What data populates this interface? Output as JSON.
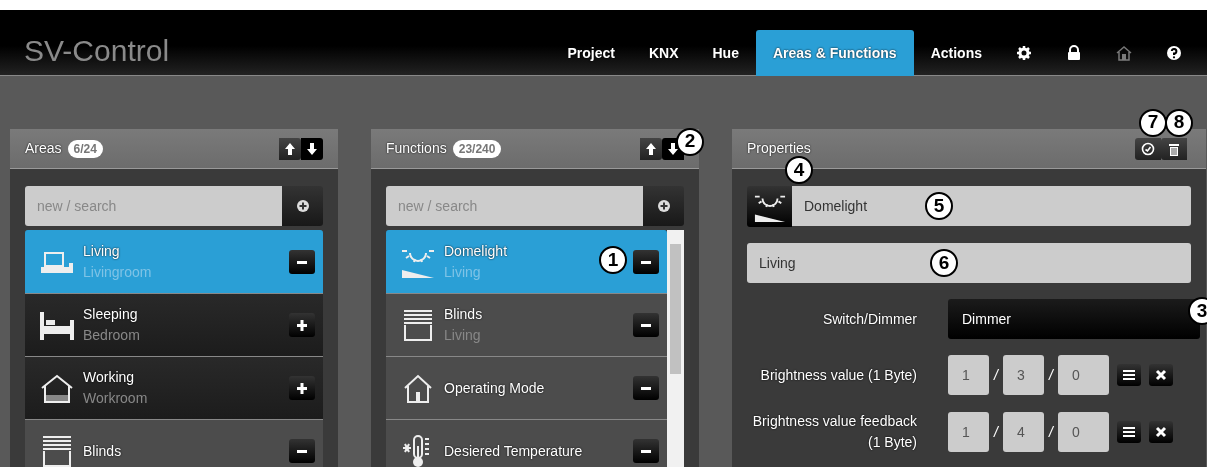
{
  "app": {
    "title": "SV-Control"
  },
  "nav": [
    {
      "kind": "text",
      "label": "Project",
      "selected": false,
      "disabled": false
    },
    {
      "kind": "text",
      "label": "KNX",
      "selected": false,
      "disabled": false
    },
    {
      "kind": "text",
      "label": "Hue",
      "selected": false,
      "disabled": false
    },
    {
      "kind": "text",
      "label": "Areas & Functions",
      "selected": true,
      "disabled": false
    },
    {
      "kind": "text",
      "label": "Actions",
      "selected": false,
      "disabled": false
    },
    {
      "kind": "gear",
      "selected": false,
      "disabled": false
    },
    {
      "kind": "lock",
      "selected": false,
      "disabled": false
    },
    {
      "kind": "home",
      "selected": false,
      "disabled": true
    },
    {
      "kind": "help",
      "selected": false,
      "disabled": false
    }
  ],
  "areas": {
    "title": "Areas",
    "count": "6/24",
    "sort": [
      {
        "kind": "up",
        "selected": false
      },
      {
        "kind": "down",
        "selected": true
      }
    ],
    "search": {
      "placeholder": "new / search"
    },
    "items": [
      {
        "kind": "sofa",
        "name": "Living",
        "room": "Livingroom",
        "selected": true,
        "assigned": true
      },
      {
        "kind": "bed",
        "name": "Sleeping",
        "room": "Bedroom",
        "selected": false,
        "assigned": false
      },
      {
        "kind": "house",
        "name": "Working",
        "room": "Workroom",
        "selected": false,
        "assigned": false
      },
      {
        "kind": "blinds",
        "name": "Blinds",
        "selected": false,
        "assigned": true
      }
    ]
  },
  "functions": {
    "title": "Functions",
    "count": "23/240",
    "sort": [
      {
        "kind": "up",
        "selected": false
      },
      {
        "kind": "down",
        "selected": true,
        "callout": "2"
      }
    ],
    "search": {
      "placeholder": "new / search"
    },
    "items": [
      {
        "kind": "light",
        "name": "Domelight",
        "room": "Living",
        "selected": true,
        "assigned": true,
        "callout": "1"
      },
      {
        "kind": "blinds",
        "name": "Blinds",
        "room": "Living",
        "selected": false,
        "assigned": true
      },
      {
        "kind": "mode",
        "name": "Operating Mode",
        "selected": false,
        "assigned": true
      },
      {
        "kind": "thermo",
        "name": "Desiered Temperature",
        "selected": false,
        "assigned": true
      }
    ]
  },
  "properties": {
    "title": "Properties",
    "actions": [
      {
        "kind": "check",
        "callout": "7"
      },
      {
        "kind": "trash",
        "callout": "8"
      }
    ],
    "icon": {
      "kind": "light",
      "callout": "4"
    },
    "name": {
      "value": "Domelight",
      "callout": "5"
    },
    "location": {
      "value": "Living",
      "callout": "6"
    },
    "fields": [
      {
        "kind": "select",
        "label": "Switch/Dimmer",
        "value": "Dimmer",
        "callout": "3"
      },
      {
        "kind": "address",
        "label": "Brightness value (1 Byte)",
        "parts": [
          "1",
          "/",
          "3",
          "/",
          "0"
        ]
      },
      {
        "kind": "address",
        "label": "Brightness value feedback (1 Byte)",
        "parts": [
          "1",
          "/",
          "4",
          "/",
          "0"
        ]
      }
    ]
  }
}
